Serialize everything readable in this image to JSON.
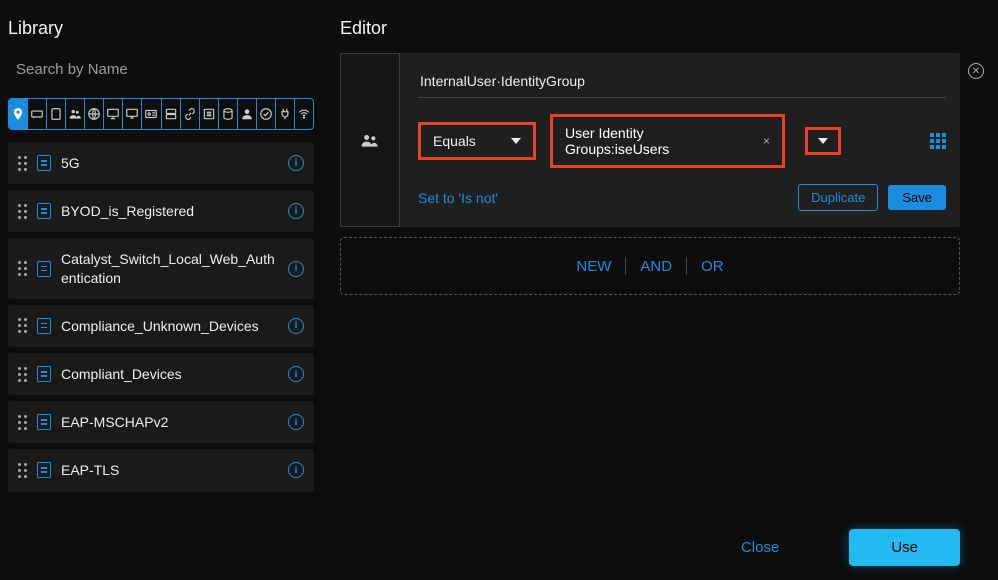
{
  "library": {
    "title": "Library",
    "search_placeholder": "Search by Name",
    "filter_icons": [
      "location-icon",
      "network-card-icon",
      "tablet-icon",
      "group-icon",
      "globe-icon",
      "monitor-icon",
      "desktop-icon",
      "id-card-icon",
      "server-icon",
      "link-icon",
      "list-icon",
      "database-icon",
      "user-icon",
      "check-circle-icon",
      "plug-icon",
      "wifi-icon"
    ],
    "items": [
      {
        "label": "5G"
      },
      {
        "label": "BYOD_is_Registered"
      },
      {
        "label": "Catalyst_Switch_Local_Web_Authentication"
      },
      {
        "label": "Compliance_Unknown_Devices"
      },
      {
        "label": "Compliant_Devices"
      },
      {
        "label": "EAP-MSCHAPv2"
      },
      {
        "label": "EAP-TLS"
      }
    ]
  },
  "editor": {
    "title": "Editor",
    "attribute": "InternalUser·IdentityGroup",
    "operator": "Equals",
    "value": "User Identity Groups:iseUsers",
    "set_isnot_label": "Set to 'Is not'",
    "duplicate_label": "Duplicate",
    "save_label": "Save",
    "new_label": "NEW",
    "and_label": "AND",
    "or_label": "OR",
    "close_label": "Close",
    "use_label": "Use",
    "close_x": "✕",
    "value_remove": "×"
  },
  "colors": {
    "accent": "#1b8de0",
    "highlight": "#e74224",
    "primary_action": "#22b8f0"
  }
}
